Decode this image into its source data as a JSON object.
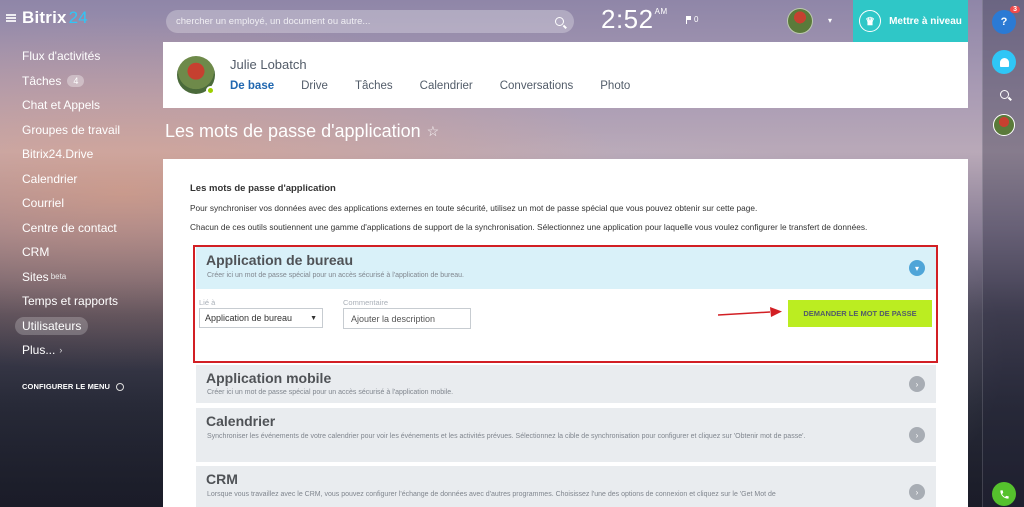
{
  "app": {
    "logo_main": "Bitrix",
    "logo_num": "24"
  },
  "sidebar": {
    "items": [
      {
        "label": "Flux d'activités"
      },
      {
        "label": "Tâches",
        "counter": "4"
      },
      {
        "label": "Chat et Appels"
      },
      {
        "label": "Groupes de travail"
      },
      {
        "label": "Bitrix24.Drive"
      },
      {
        "label": "Calendrier"
      },
      {
        "label": "Courriel"
      },
      {
        "label": "Centre de contact"
      },
      {
        "label": "CRM"
      },
      {
        "label": "Sites",
        "suffix": "beta"
      },
      {
        "label": "Temps et rapports"
      },
      {
        "label": "Utilisateurs"
      },
      {
        "label": "Plus...",
        "arrow": "›"
      }
    ],
    "configure_label": "CONFIGURER LE MENU"
  },
  "topbar": {
    "search_placeholder": "chercher un employé, un document ou autre...",
    "clock": "2:52",
    "clock_ampm": "AM",
    "flag_count": "0",
    "upgrade_label": "Mettre à niveau"
  },
  "rail": {
    "help_badge": "3",
    "help_label": "?"
  },
  "profile": {
    "name": "Julie Lobatch",
    "tabs": [
      {
        "label": "De base"
      },
      {
        "label": "Drive"
      },
      {
        "label": "Tâches"
      },
      {
        "label": "Calendrier"
      },
      {
        "label": "Conversations"
      },
      {
        "label": "Photo"
      }
    ]
  },
  "page": {
    "title": "Les mots de passe d'application",
    "section_title": "Les mots de passe d'application",
    "desc1": "Pour synchroniser vos données avec des applications externes en toute sécurité, utilisez un mot de passe spécial que vous pouvez obtenir sur cette page.",
    "desc2": "Chacun de ces outils soutiennent une gamme d'applications de support de la synchronisation. Sélectionnez une application pour laquelle vous voulez configurer le transfert de données."
  },
  "accordions": {
    "desktop": {
      "title": "Application de bureau",
      "subtitle": "Créer ici un mot de passe spécial pour un accès sécurisé à l'application de bureau.",
      "linked_label": "Lié à",
      "select_value": "Application de bureau",
      "comment_label": "Commentaire",
      "comment_placeholder": "Ajouter la description",
      "button_label": "DEMANDER LE MOT DE PASSE"
    },
    "mobile": {
      "title": "Application mobile",
      "subtitle": "Créer ici un mot de passe spécial pour un accès sécurisé à l'application mobile."
    },
    "calendar": {
      "title": "Calendrier",
      "subtitle": "Synchroniser les événements de votre calendrier pour voir les événements et les activités prévues. Sélectionnez la cible de synchronisation pour configurer et cliquez sur 'Obtenir mot de passe'."
    },
    "crm": {
      "title": "CRM",
      "subtitle": "Lorsque vous travaillez avec le CRM, vous pouvez configurer l'échange de données avec d'autres programmes. Choisissez l'une des options de connexion et cliquez sur le 'Get Mot de"
    }
  },
  "colors": {
    "accent": "#2fc7c7",
    "primary_button": "#bbed21",
    "highlight_frame": "#d21f24",
    "link_active": "#2067b0"
  }
}
